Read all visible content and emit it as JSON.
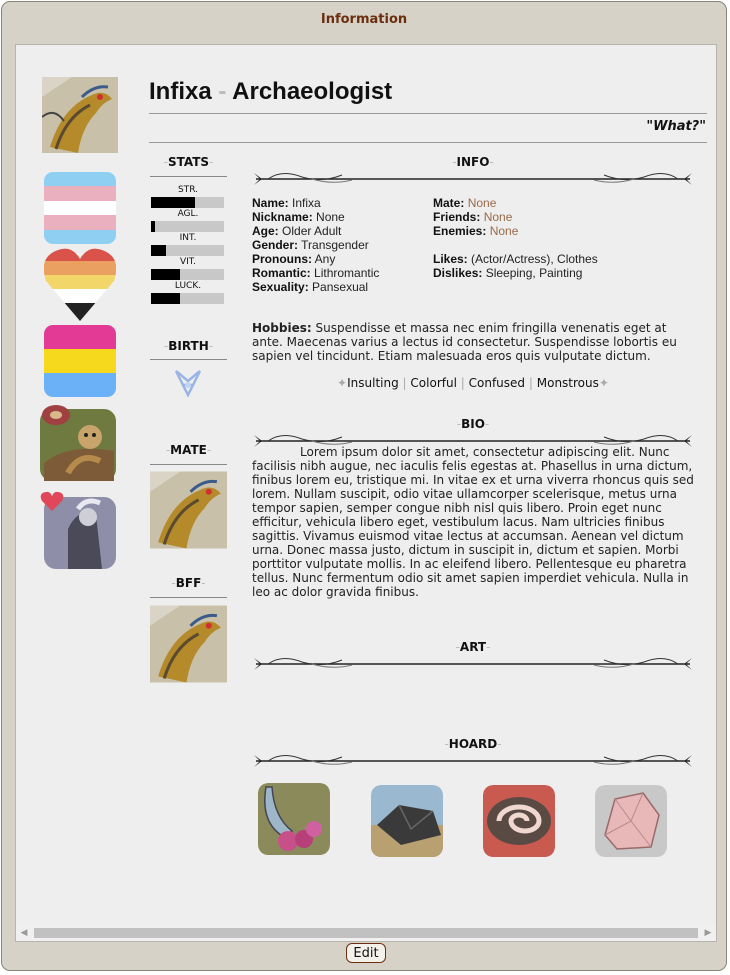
{
  "window": {
    "title": "Information"
  },
  "profile": {
    "name": "Infixa",
    "separator": "-",
    "occupation": "Archaeologist",
    "quote": "\"What?\""
  },
  "sections": {
    "stats": "STATS",
    "birth": "BIRTH",
    "mate": "MATE",
    "bff": "BFF",
    "info": "INFO",
    "bio": "BIO",
    "art": "ART",
    "hoard": "HOARD"
  },
  "stats": [
    {
      "label": "STR.",
      "value": 0.6
    },
    {
      "label": "AGL.",
      "value": 0.05
    },
    {
      "label": "INT.",
      "value": 0.2
    },
    {
      "label": "VIT.",
      "value": 0.4
    },
    {
      "label": "LUCK.",
      "value": 0.4
    }
  ],
  "info_left": [
    {
      "key": "Name:",
      "value": "Infixa"
    },
    {
      "key": "Nickname:",
      "value": "None"
    },
    {
      "key": "Age:",
      "value": "Older Adult"
    },
    {
      "key": "Gender:",
      "value": "Transgender"
    },
    {
      "key": "Pronouns:",
      "value": "Any"
    },
    {
      "key": "Romantic:",
      "value": "Lithromantic"
    },
    {
      "key": "Sexuality:",
      "value": "Pansexual"
    }
  ],
  "info_right": [
    {
      "key": "Mate:",
      "value": "None"
    },
    {
      "key": "Friends:",
      "value": "None"
    },
    {
      "key": "Enemies:",
      "value": "None"
    },
    {
      "key": "Likes:",
      "value": "(Actor/Actress), Clothes"
    },
    {
      "key": "Dislikes:",
      "value": "Sleeping, Painting"
    }
  ],
  "hobbies": {
    "label": "Hobbies:",
    "text": "Suspendisse et massa nec enim fringilla venenatis eget at ante. Maecenas varius a lectus id consectetur. Suspendisse lobortis eu sapien vel tincidunt. Etiam malesuada eros quis vulputate dictum."
  },
  "traits": [
    "Insulting",
    "Colorful",
    "Confused",
    "Monstrous"
  ],
  "bio": "Lorem ipsum dolor sit amet, consectetur adipiscing elit. Nunc facilisis nibh augue, nec iaculis felis egestas at. Phasellus in urna dictum, finibus lorem eu, tristique mi. In vitae ex et urna viverra rhoncus quis sed lorem. Nullam suscipit, odio vitae ullamcorper scelerisque, metus urna tempor sapien, semper congue nibh nisl quis libero. Proin eget nunc efficitur, vehicula libero eget, vestibulum lacus. Nam ultricies finibus sagittis. Vivamus euismod vitae lectus at accumsan. Aenean vel dictum urna. Donec massa justo, dictum in suscipit in, dictum et sapien. Morbi porttitor vulputate mollis. In ac eleifend libero. Pellentesque eu pharetra tellus. Nunc fermentum odio sit amet sapien imperdiet vehicula. Nulla in leo ac dolor gravida finibus.",
  "footer": {
    "edit_label": "Edit"
  },
  "colors": {
    "link": "#9a6a4a",
    "accent": "#6b2f10",
    "panel": "#eeeeee",
    "frame": "#d7d2c8"
  }
}
